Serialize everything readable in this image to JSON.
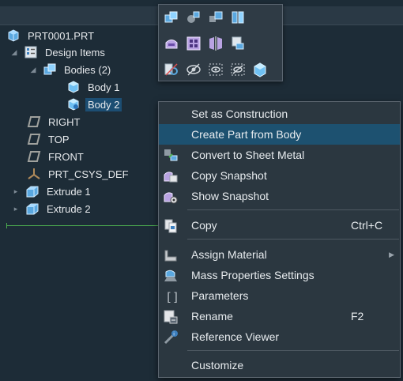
{
  "colors": {
    "panel_bg": "#1d2c37",
    "selection": "#1c4e73",
    "menu_bg": "#2b3740",
    "menu_highlight": "#1d5170",
    "drop_indicator": "#4caf50",
    "body_icon": "#8fd3ff"
  },
  "tree": {
    "root": {
      "label": "PRT0001.PRT",
      "icon": "part-icon"
    },
    "design_items": {
      "label": "Design Items",
      "icon": "design-items-icon"
    },
    "bodies": {
      "label": "Bodies (2)",
      "icon": "bodies-icon"
    },
    "body1": {
      "label": "Body 1",
      "icon": "body-icon"
    },
    "body2": {
      "label": "Body 2",
      "icon": "body-icon"
    },
    "right": {
      "label": "RIGHT",
      "icon": "datum-plane-icon"
    },
    "top": {
      "label": "TOP",
      "icon": "datum-plane-icon"
    },
    "front": {
      "label": "FRONT",
      "icon": "datum-plane-icon"
    },
    "csys": {
      "label": "PRT_CSYS_DEF",
      "icon": "csys-icon"
    },
    "extrude1": {
      "label": "Extrude 1",
      "icon": "extrude-icon"
    },
    "extrude2": {
      "label": "Extrude 2",
      "icon": "extrude-icon"
    }
  },
  "mini_toolbar": {
    "row1": [
      "boolean-icon",
      "split-icon",
      "transform-icon",
      "body-edit-icon"
    ],
    "row2": [
      "remove-body-icon",
      "pattern-icon",
      "mirror-icon",
      "new-body-icon"
    ],
    "row3": [
      "hide-others-icon",
      "hide-icon",
      "isolate-icon",
      "hide-all-icon",
      "show-icon"
    ]
  },
  "context_menu": {
    "items": [
      {
        "label": "Set as Construction",
        "icon": ""
      },
      {
        "label": "Create Part from Body",
        "icon": ""
      },
      {
        "label": "Convert to Sheet Metal",
        "icon": "convert-sheetmetal-icon"
      },
      {
        "label": "Copy Snapshot",
        "icon": "copy-snapshot-icon"
      },
      {
        "label": "Show Snapshot",
        "icon": "show-snapshot-icon"
      },
      {
        "label": "Copy",
        "shortcut": "Ctrl+C",
        "icon": "copy-icon"
      },
      {
        "label": "Assign Material",
        "icon": "assign-material-icon"
      },
      {
        "label": "Mass Properties Settings",
        "icon": "mass-properties-icon"
      },
      {
        "label": "Parameters",
        "icon": "parameters-icon"
      },
      {
        "label": "Rename",
        "shortcut": "F2",
        "icon": "rename-icon"
      },
      {
        "label": "Reference Viewer",
        "icon": "reference-viewer-icon"
      },
      {
        "label": "Customize",
        "icon": ""
      }
    ]
  }
}
